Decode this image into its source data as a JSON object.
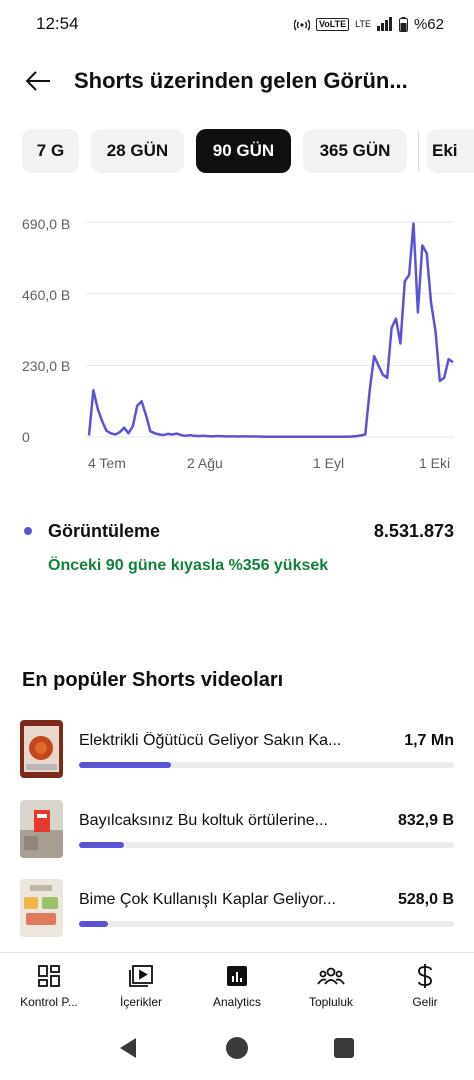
{
  "status_bar": {
    "time": "12:54",
    "volte": "VoLTE",
    "network": "LTE",
    "battery": "%62"
  },
  "header": {
    "title": "Shorts üzerinden gelen Görün..."
  },
  "period_chips": [
    {
      "label": "7 G",
      "selected": false
    },
    {
      "label": "28 GÜN",
      "selected": false
    },
    {
      "label": "90 GÜN",
      "selected": true
    },
    {
      "label": "365 GÜN",
      "selected": false
    },
    {
      "label": "Eki",
      "selected": false
    }
  ],
  "chart_data": {
    "type": "line",
    "y_ticks": [
      "690,0 B",
      "460,0 B",
      "230,0 B",
      "0"
    ],
    "x_ticks": [
      "4 Tem",
      "2 Ağu",
      "1 Eyl",
      "1 Eki"
    ],
    "ylim": [
      0,
      690000
    ],
    "y_tick_values": [
      690000,
      460000,
      230000,
      0
    ],
    "grid": true,
    "line_color": "#5b53d6",
    "series": [
      {
        "values": [
          5000,
          150000,
          90000,
          50000,
          20000,
          12000,
          8000,
          15000,
          30000,
          12000,
          35000,
          100000,
          115000,
          70000,
          18000,
          12000,
          8000,
          6000,
          10000,
          8000,
          11000,
          6000,
          4000,
          6000,
          4000,
          3000,
          4000,
          3000,
          2000,
          3000,
          3000,
          2000,
          2000,
          2000,
          1500,
          2000,
          2000,
          1500,
          1500,
          1500,
          1000,
          1000,
          1000,
          1000,
          1000,
          800,
          800,
          800,
          800,
          800,
          800,
          800,
          800,
          800,
          900,
          900,
          900,
          900,
          1000,
          1200,
          1500,
          3000,
          5000,
          8000,
          150000,
          260000,
          230000,
          200000,
          190000,
          350000,
          380000,
          300000,
          500000,
          520000,
          685000,
          400000,
          615000,
          590000,
          430000,
          340000,
          180000,
          190000,
          250000,
          240000
        ]
      }
    ]
  },
  "metric": {
    "label": "Görüntüleme",
    "value": "8.531.873",
    "comparison": "Önceki 90 güne kıyasla %356 yüksek",
    "color": "#5b53d6"
  },
  "top_shorts": {
    "title": "En popüler Shorts videoları",
    "items": [
      {
        "title": "Elektrikli Öğütücü Geliyor Sakın Ka...",
        "views": "1,7 Mn",
        "share": 0.245
      },
      {
        "title": "Bayılcaksınız Bu koltuk  örtülerine...",
        "views": "832,9 B",
        "share": 0.12
      },
      {
        "title": "Bime Çok Kullanışlı Kaplar Geliyor...",
        "views": "528,0 B",
        "share": 0.076
      }
    ]
  },
  "bottom_nav": [
    {
      "label": "Kontrol P...",
      "icon": "dashboard-icon"
    },
    {
      "label": "İçerikler",
      "icon": "content-icon"
    },
    {
      "label": "Analytics",
      "icon": "analytics-icon"
    },
    {
      "label": "Topluluk",
      "icon": "community-icon"
    },
    {
      "label": "Gelir",
      "icon": "earn-icon"
    }
  ]
}
